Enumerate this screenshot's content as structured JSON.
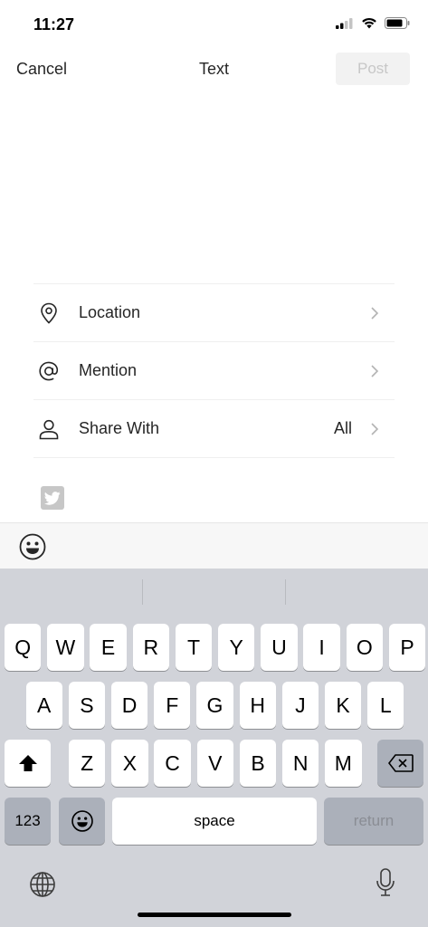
{
  "status": {
    "time": "11:27"
  },
  "nav": {
    "cancel": "Cancel",
    "title": "Text",
    "post": "Post"
  },
  "options": [
    {
      "label": "Location",
      "value": "",
      "icon": "location-pin-icon"
    },
    {
      "label": "Mention",
      "value": "",
      "icon": "at-sign-icon"
    },
    {
      "label": "Share With",
      "value": "All",
      "icon": "person-icon"
    }
  ],
  "keyboard": {
    "row1": [
      "Q",
      "W",
      "E",
      "R",
      "T",
      "Y",
      "U",
      "I",
      "O",
      "P"
    ],
    "row2": [
      "A",
      "S",
      "D",
      "F",
      "G",
      "H",
      "J",
      "K",
      "L"
    ],
    "row3": [
      "Z",
      "X",
      "C",
      "V",
      "B",
      "N",
      "M"
    ],
    "numbers": "123",
    "space": "space",
    "return": "return"
  },
  "colors": {
    "accent_disabled": "#c7c7c7",
    "keyboard_bg": "#d1d3d9",
    "fn_key": "#abb0ba"
  }
}
